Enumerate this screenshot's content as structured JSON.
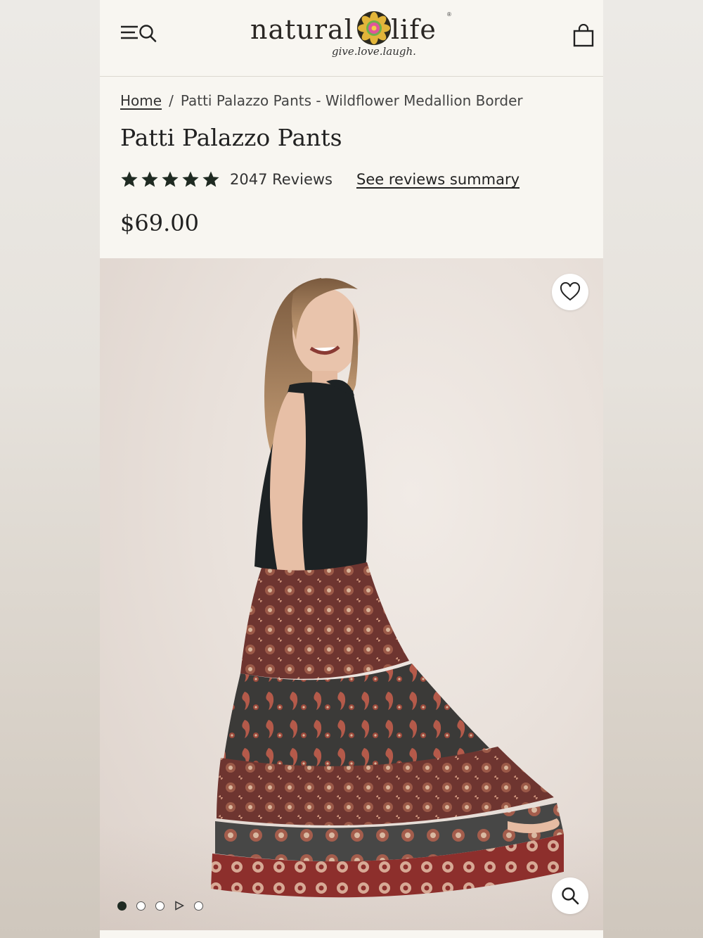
{
  "header": {
    "logo_word_left": "natural",
    "logo_word_right": "life",
    "logo_tagline": "give.love.laugh.",
    "logo_reg": "®",
    "menu_icon": "menu-search-icon",
    "cart_icon": "shopping-bag-icon"
  },
  "breadcrumb": {
    "home": "Home",
    "separator": "/",
    "current": "Patti Palazzo Pants - Wildflower Medallion Border"
  },
  "product": {
    "title": "Patti Palazzo Pants",
    "rating": 5,
    "reviews_count": "2047 Reviews",
    "reviews_link": "See reviews summary",
    "price": "$69.00"
  },
  "gallery": {
    "favorite_icon": "heart-icon",
    "zoom_icon": "magnifier-icon",
    "total_slides": 5,
    "active_slide": 1,
    "video_slide": 4
  },
  "colors": {
    "accent_dark": "#1f2a22",
    "page_bg": "#f8f6f1"
  }
}
